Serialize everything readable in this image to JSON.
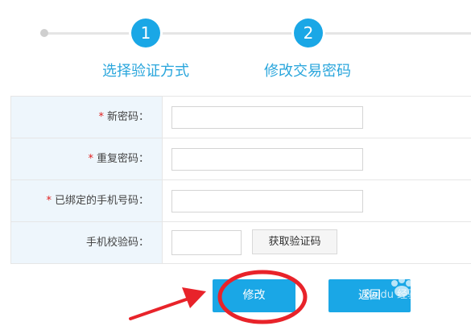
{
  "steps": [
    {
      "number": "1",
      "label": "选择验证方式"
    },
    {
      "number": "2",
      "label": "修改交易密码"
    }
  ],
  "form": {
    "new_password": {
      "required_mark": "*",
      "label": "新密码：",
      "value": ""
    },
    "repeat_password": {
      "required_mark": "*",
      "label": "重复密码：",
      "value": ""
    },
    "bound_phone": {
      "required_mark": "*",
      "label": "已绑定的手机号码：",
      "value": ""
    },
    "phone_code": {
      "label": "手机校验码：",
      "value": "",
      "button": "获取验证码"
    }
  },
  "actions": {
    "modify": "修改",
    "back": "返回"
  },
  "watermark": "Baidu 经验",
  "colors": {
    "accent": "#1aa7e6",
    "label_bg": "#eef6fc",
    "required": "#e02020",
    "annotation_red": "#e8232a"
  }
}
